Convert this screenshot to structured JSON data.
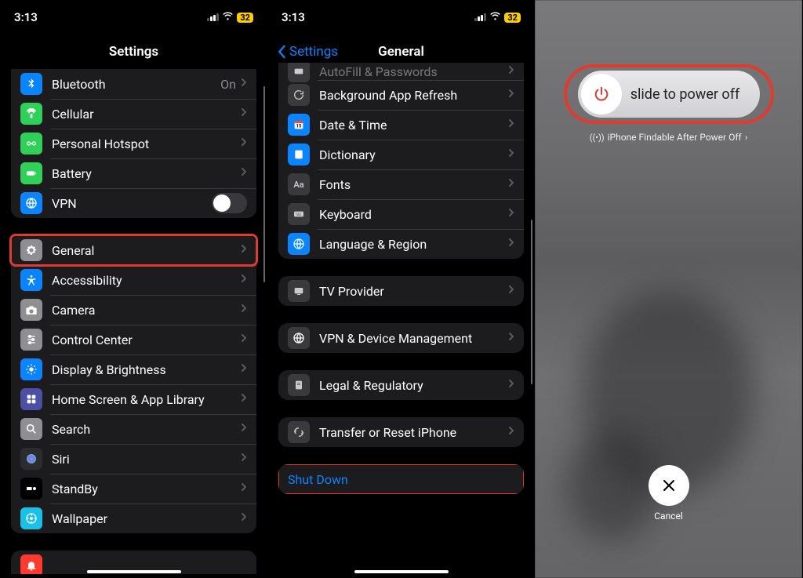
{
  "status": {
    "time": "3:13",
    "battery": "32"
  },
  "screen1": {
    "title": "Settings",
    "group1": [
      {
        "icon": "bluetooth",
        "bg": "#0a84ff",
        "label": "Bluetooth",
        "value": "On"
      },
      {
        "icon": "cellular",
        "bg": "#30d158",
        "label": "Cellular"
      },
      {
        "icon": "hotspot",
        "bg": "#30d158",
        "label": "Personal Hotspot"
      },
      {
        "icon": "battery",
        "bg": "#30d158",
        "label": "Battery"
      },
      {
        "icon": "vpn",
        "bg": "#0a84ff",
        "label": "VPN",
        "toggle": true
      }
    ],
    "group2": [
      {
        "icon": "gear",
        "bg": "#8e8e93",
        "label": "General",
        "highlighted": true
      },
      {
        "icon": "accessibility",
        "bg": "#0a84ff",
        "label": "Accessibility"
      },
      {
        "icon": "camera",
        "bg": "#8e8e93",
        "label": "Camera"
      },
      {
        "icon": "control",
        "bg": "#8e8e93",
        "label": "Control Center"
      },
      {
        "icon": "display",
        "bg": "#0a84ff",
        "label": "Display & Brightness"
      },
      {
        "icon": "home",
        "bg": "#4c4fa3",
        "label": "Home Screen & App Library"
      },
      {
        "icon": "search",
        "bg": "#8e8e93",
        "label": "Search"
      },
      {
        "icon": "siri",
        "bg": "#2c2c2e",
        "label": "Siri"
      },
      {
        "icon": "standby",
        "bg": "#000000",
        "label": "StandBy"
      },
      {
        "icon": "wallpaper",
        "bg": "#17c1e8",
        "label": "Wallpaper"
      }
    ]
  },
  "screen2": {
    "back": "Settings",
    "title": "General",
    "group1": [
      {
        "icon": "autofill",
        "label": "AutoFill & Passwords",
        "cut": true
      },
      {
        "icon": "refresh",
        "label": "Background App Refresh"
      },
      {
        "icon": "date",
        "label": "Date & Time",
        "blue": true
      },
      {
        "icon": "dictionary",
        "label": "Dictionary",
        "blue": true
      },
      {
        "icon": "fonts",
        "label": "Fonts",
        "txt": "Aa"
      },
      {
        "icon": "keyboard",
        "label": "Keyboard"
      },
      {
        "icon": "language",
        "label": "Language & Region",
        "blue": true
      }
    ],
    "group2": [
      {
        "icon": "tv",
        "label": "TV Provider"
      }
    ],
    "group3": [
      {
        "icon": "vpn",
        "label": "VPN & Device Management"
      }
    ],
    "group4": [
      {
        "icon": "legal",
        "label": "Legal & Regulatory"
      }
    ],
    "group5": [
      {
        "icon": "transfer",
        "label": "Transfer or Reset iPhone"
      }
    ],
    "shutdown": "Shut Down"
  },
  "screen3": {
    "slide": "slide to power off",
    "findable": "iPhone Findable After Power Off",
    "cancel": "Cancel"
  }
}
